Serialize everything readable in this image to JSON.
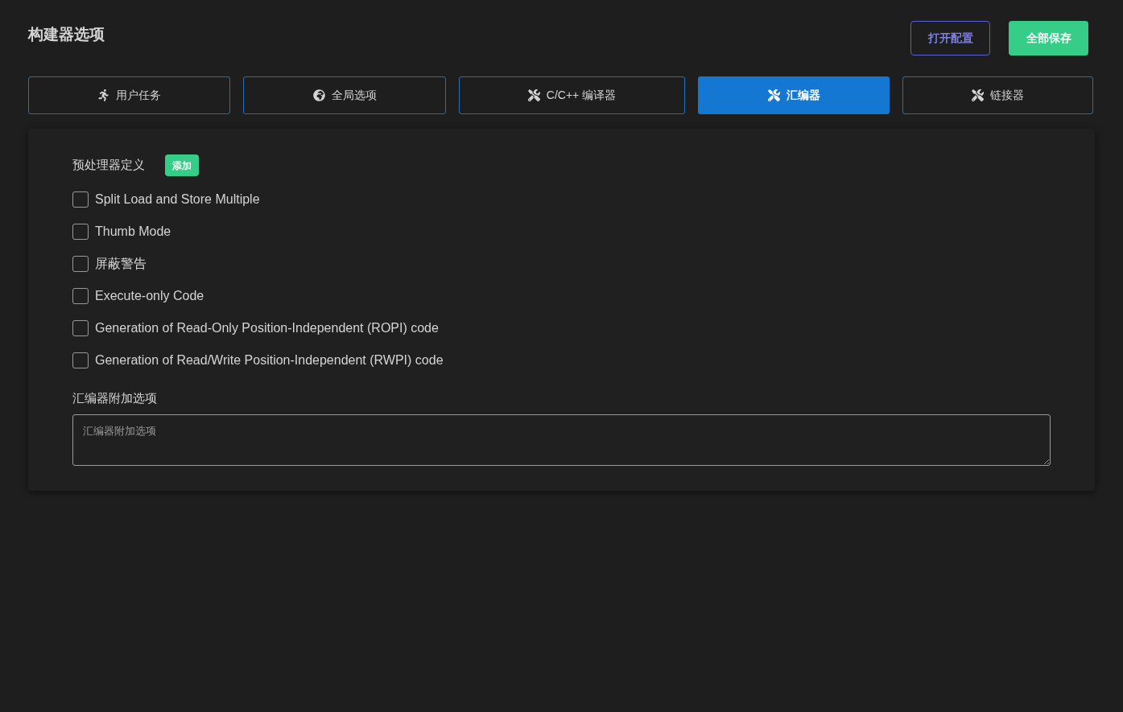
{
  "header": {
    "title": "构建器选项",
    "buttons": [
      {
        "label": "打开配置",
        "kind": "outline"
      },
      {
        "label": "全部保存",
        "kind": "primary"
      }
    ]
  },
  "tabs": [
    {
      "label": "用户任务",
      "kind": "task",
      "selected": false
    },
    {
      "label": "全局选项",
      "kind": "global",
      "selected": false
    },
    {
      "label": "C/C++ 编译器",
      "kind": "tool",
      "selected": false
    },
    {
      "label": "汇编器",
      "kind": "tool",
      "selected": true
    },
    {
      "label": "链接器",
      "kind": "tool",
      "selected": false
    }
  ],
  "panel": {
    "defines": {
      "label": "预处理器定义",
      "button": "添加"
    },
    "options": [
      {
        "label": "Split Load and Store Multiple",
        "checked": false
      },
      {
        "label": "Thumb Mode",
        "checked": false
      },
      {
        "label": "屏蔽警告",
        "checked": false
      },
      {
        "label": "Execute-only Code",
        "checked": false
      },
      {
        "label": "Generation of Read-Only Position-Independent (ROPI) code",
        "checked": false
      },
      {
        "label": "Generation of Read/Write Position-Independent (RWPI) code",
        "checked": false
      }
    ],
    "extra": {
      "label": "汇编器附加选项",
      "placeholder": "汇编器附加选项"
    }
  }
}
